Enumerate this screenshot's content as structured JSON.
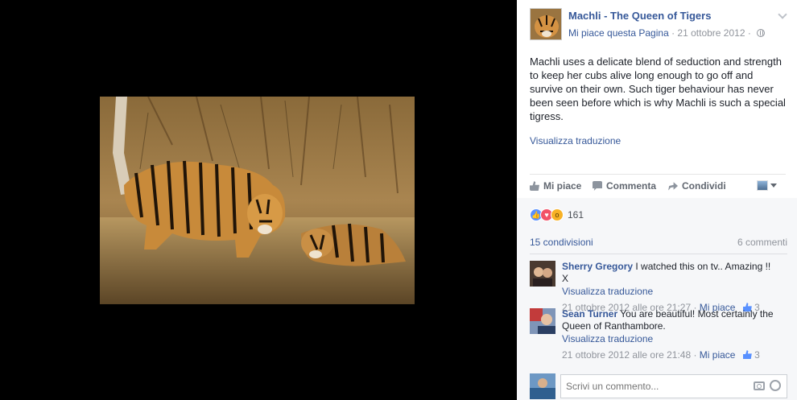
{
  "post": {
    "page_name": "Machli - The Queen of Tigers",
    "liked_label": "Mi piace questa Pagina",
    "separator": " · ",
    "date": "21 ottobre 2012",
    "text": "Machli uses a delicate blend of seduction and strength to keep her cubs alive long enough to go off and survive on their own. Such tiger behaviour has never been seen before which is why Machli is such a special tigress.",
    "translate_label": "Visualizza traduzione"
  },
  "actions": {
    "like": "Mi piace",
    "comment": "Commenta",
    "share": "Condividi"
  },
  "reactions": {
    "count": "161",
    "icons": [
      "like-icon",
      "love-icon",
      "wow-icon"
    ]
  },
  "stats": {
    "shares": "15 condivisioni",
    "comments": "6 commenti"
  },
  "comments": [
    {
      "author": "Sherry Gregory",
      "text": "I watched this on tv.. Amazing !! X",
      "translate": "Visualizza traduzione",
      "time": "21 ottobre 2012 alle ore 21:27",
      "like_label": "Mi piace",
      "likes": "3"
    },
    {
      "author": "Sean Turner",
      "text": "You are beautiful! Most certainly the Queen of Ranthambore.",
      "translate": "Visualizza traduzione",
      "time": "21 ottobre 2012 alle ore 21:48",
      "like_label": "Mi piace",
      "likes": "3"
    }
  ],
  "composer": {
    "placeholder": "Scrivi un commento..."
  },
  "colors": {
    "link": "#365899",
    "muted": "#90949c",
    "text": "#1d2129",
    "like": "#5890ff",
    "love": "#f25268",
    "wow": "#f7b125"
  }
}
